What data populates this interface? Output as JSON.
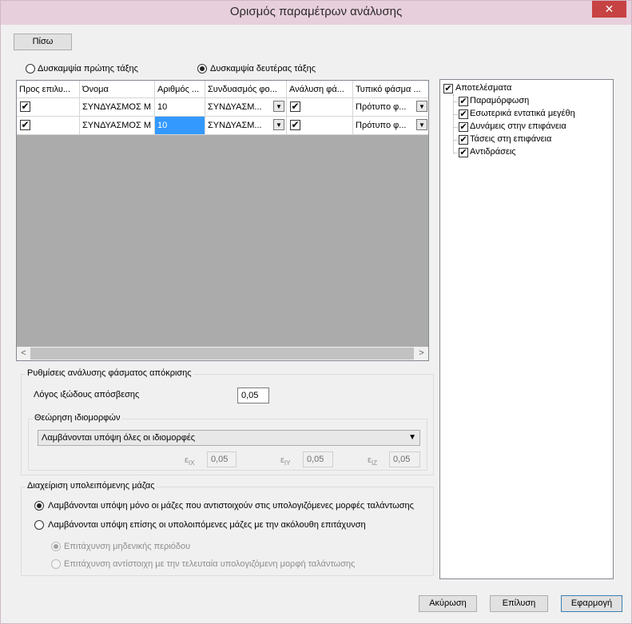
{
  "window": {
    "title": "Ορισμός παραμέτρων ανάλυσης",
    "close": "✕"
  },
  "back_button": "Πίσω",
  "stiffness": {
    "first_order": "Δυσκαμψία πρώτης τάξης",
    "second_order": "Δυσκαμψία δευτέρας τάξης",
    "selected": "second_order"
  },
  "grid": {
    "headers": [
      "Προς επιλυ...",
      "Όνομα",
      "Αριθμός ...",
      "Συνδυασμός φο...",
      "Ανάλυση φά...",
      "Τυπικό φάσμα ..."
    ],
    "rows": [
      {
        "name": "ΣΥΝΔΥΑΣΜΟΣ Μ",
        "number": "10",
        "combination": "ΣΥΝΔΥΑΣΜ...",
        "spectrum": "Πρότυπο φ..."
      },
      {
        "name": "ΣΥΝΔΥΑΣΜΟΣ Μ",
        "number": "10",
        "combination": "ΣΥΝΔΥΑΣΜ...",
        "spectrum": "Πρότυπο φ..."
      }
    ],
    "scroll_left": "<",
    "scroll_right": ">"
  },
  "response_spectrum": {
    "title": "Ρυθμίσεις ανάλυσης φάσματος απόκρισης",
    "damping_label": "Λόγος ιξώδους απόσβεσης",
    "damping_value": "0,05",
    "modes": {
      "title": "Θεώρηση ιδιομορφών",
      "select_value": "Λαμβάνονται υπόψη όλες οι ιδιομορφές",
      "eps_symbol": "ε",
      "eps_ix_sub": "IX",
      "eps_ix": "0,05",
      "eps_iy_sub": "IY",
      "eps_iy": "0,05",
      "eps_iz_sub": "IZ",
      "eps_iz": "0,05"
    }
  },
  "residual_mass": {
    "title": "Διαχείριση υπολειπόμενης μάζας",
    "option1": "Λαμβάνονται υπόψη μόνο οι μάζες που αντιστοιχούν στις υπολογιζόμενες μορφές ταλάντωσης",
    "option2": "Λαμβάνονται υπόψη επίσης οι υπολοιπόμενες μάζες με την ακόλουθη επιτάχυνση",
    "sub1": "Επιτάχυνση μηδενικής περιόδου",
    "sub2": "Επιτάχυνση αντίστοιχη με την τελευταία υπολογιζόμενη μορφή ταλάντωσης"
  },
  "results": {
    "root": "Αποτελέσματα",
    "items": [
      "Παραμόρφωση",
      "Εσωτερικά εντατικά μεγέθη",
      "Δυνάμεις στην επιφάνεια",
      "Τάσεις στη επιφάνεια",
      "Αντιδράσεις"
    ]
  },
  "buttons": {
    "cancel": "Ακύρωση",
    "solve": "Επίλυση",
    "apply": "Εφαρμογή"
  },
  "check_glyph": "✔",
  "dropdown_glyph": "▼"
}
